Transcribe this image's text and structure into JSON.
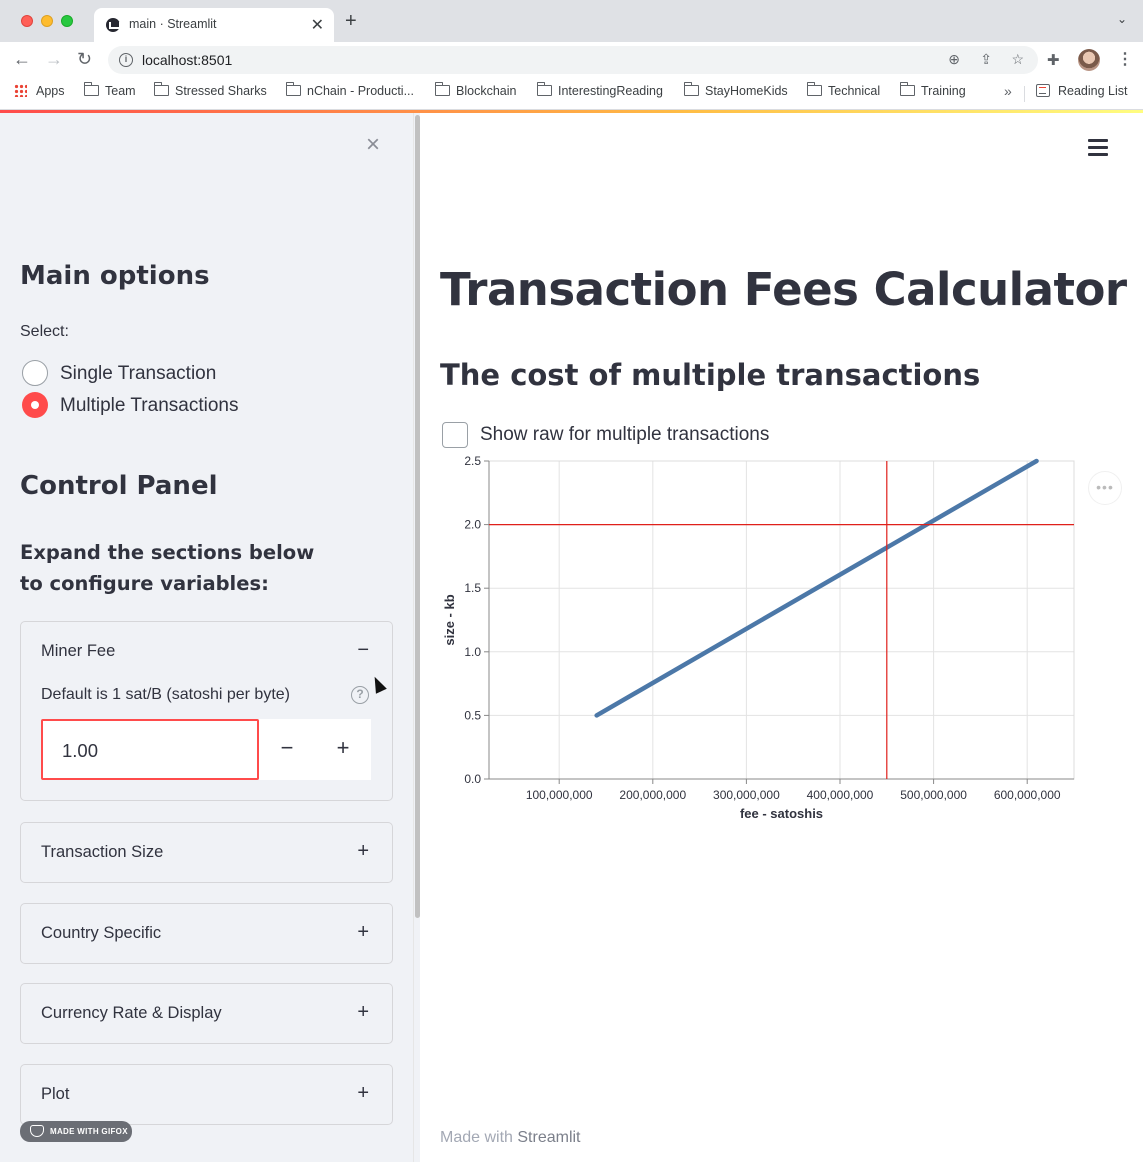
{
  "browser": {
    "tab_title": "main · Streamlit",
    "url": "localhost:8501",
    "bookmarks": [
      "Apps",
      "Team",
      "Stressed Sharks",
      "nChain - Producti...",
      "Blockchain",
      "InterestingReading",
      "StayHomeKids",
      "Technical",
      "Training"
    ],
    "bookmarks_more": "»",
    "reading_list": "Reading List"
  },
  "sidebar": {
    "close_glyph": "×",
    "main_options_title": "Main options",
    "select_label": "Select:",
    "radio_options": [
      "Single Transaction",
      "Multiple Transactions"
    ],
    "radio_selected": "Multiple Transactions",
    "control_panel_title": "Control Panel",
    "expand_text": "Expand the sections below to configure variables:",
    "miner_fee": {
      "title": "Miner Fee",
      "toggle": "−",
      "help_text": "Default is 1 sat/B (satoshi per byte)",
      "help_icon": "?",
      "value": "1.00",
      "minus": "−",
      "plus": "+"
    },
    "expanders": [
      {
        "title": "Transaction Size",
        "toggle": "+"
      },
      {
        "title": "Country Specific",
        "toggle": "+"
      },
      {
        "title": "Currency Rate & Display",
        "toggle": "+"
      },
      {
        "title": "Plot",
        "toggle": "+"
      }
    ],
    "gifox_badge": "MADE WITH GIFOX"
  },
  "main": {
    "title": "Transaction Fees Calculator",
    "subheader": "The cost of multiple transactions",
    "checkbox_label": "Show raw for multiple transactions",
    "chart_menu_glyph": "•••",
    "footer_prefix": "Made with",
    "footer_brand": "Streamlit"
  },
  "colors": {
    "accent": "#ff4b4b",
    "line": "#4c78a8",
    "rule": "#e0201b"
  },
  "chart_data": {
    "type": "line",
    "xlabel": "fee - satoshis",
    "ylabel": "size - kb",
    "xlim": [
      25000000,
      650000000
    ],
    "ylim": [
      0,
      2.5
    ],
    "x_ticks": [
      100000000,
      200000000,
      300000000,
      400000000,
      500000000,
      600000000
    ],
    "x_tick_labels": [
      "100,000,000",
      "200,000,000",
      "300,000,000",
      "400,000,000",
      "500,000,000",
      "600,000,000"
    ],
    "y_ticks": [
      0,
      0.5,
      1.0,
      1.5,
      2.0,
      2.5
    ],
    "y_tick_labels": [
      "0.0",
      "0.5",
      "1.0",
      "1.5",
      "2.0",
      "2.5"
    ],
    "grid": true,
    "series": [
      {
        "x": [
          140000000,
          610000000
        ],
        "values": [
          0.5,
          2.5
        ]
      }
    ],
    "reference_lines": {
      "x": 450000000,
      "y": 2.0
    }
  }
}
